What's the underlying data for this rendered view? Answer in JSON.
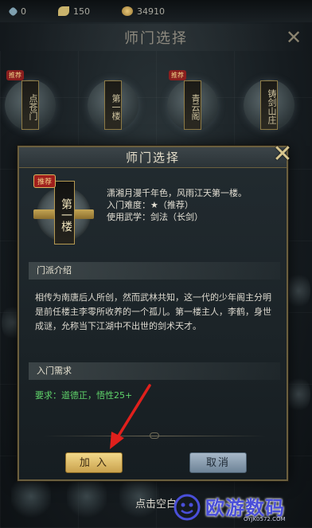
{
  "topbar": {
    "resources": [
      {
        "icon": "gem-icon",
        "value": "0"
      },
      {
        "icon": "wing-icon",
        "value": "150"
      },
      {
        "icon": "coin-icon",
        "value": "34910"
      }
    ]
  },
  "background": {
    "title": "师门选择",
    "sects": [
      {
        "name": "点苍门",
        "tag": "推荐"
      },
      {
        "name": "第一楼",
        "tag": ""
      },
      {
        "name": "青云阁",
        "tag": "推荐"
      },
      {
        "name": "铸剑山庄",
        "tag": ""
      }
    ],
    "hint": "点击空白"
  },
  "modal": {
    "title": "师门选择",
    "emblem": {
      "tag": "推荐",
      "name": "第一楼"
    },
    "intro_line1": "潇湘月漫千年色，风雨江天第一楼。",
    "difficulty_label": "入门难度：",
    "difficulty_stars": "★",
    "difficulty_note": "（推荐）",
    "weapon_label": "使用武学：",
    "weapon_value": "剑法（长剑）",
    "section_intro": "门派介绍",
    "description": "相传为南唐后人所创，然而武林共知，这一代的少年阁主分明是前任楼主李零所收养的一个孤儿。第一楼主人，李鹤，身世成谜，允称当下江湖中不出世的剑术天才。",
    "section_req": "入门需求",
    "requirement": "要求：道德正，悟性25+",
    "btn_join": "加 入",
    "btn_cancel": "取消"
  },
  "watermark": {
    "text": "欧游数码",
    "url": "OYJK0572.COM"
  },
  "colors": {
    "accent_gold": "#c9a24e",
    "req_green": "#5fd36a",
    "watermark_blue": "#4a4fd9"
  }
}
